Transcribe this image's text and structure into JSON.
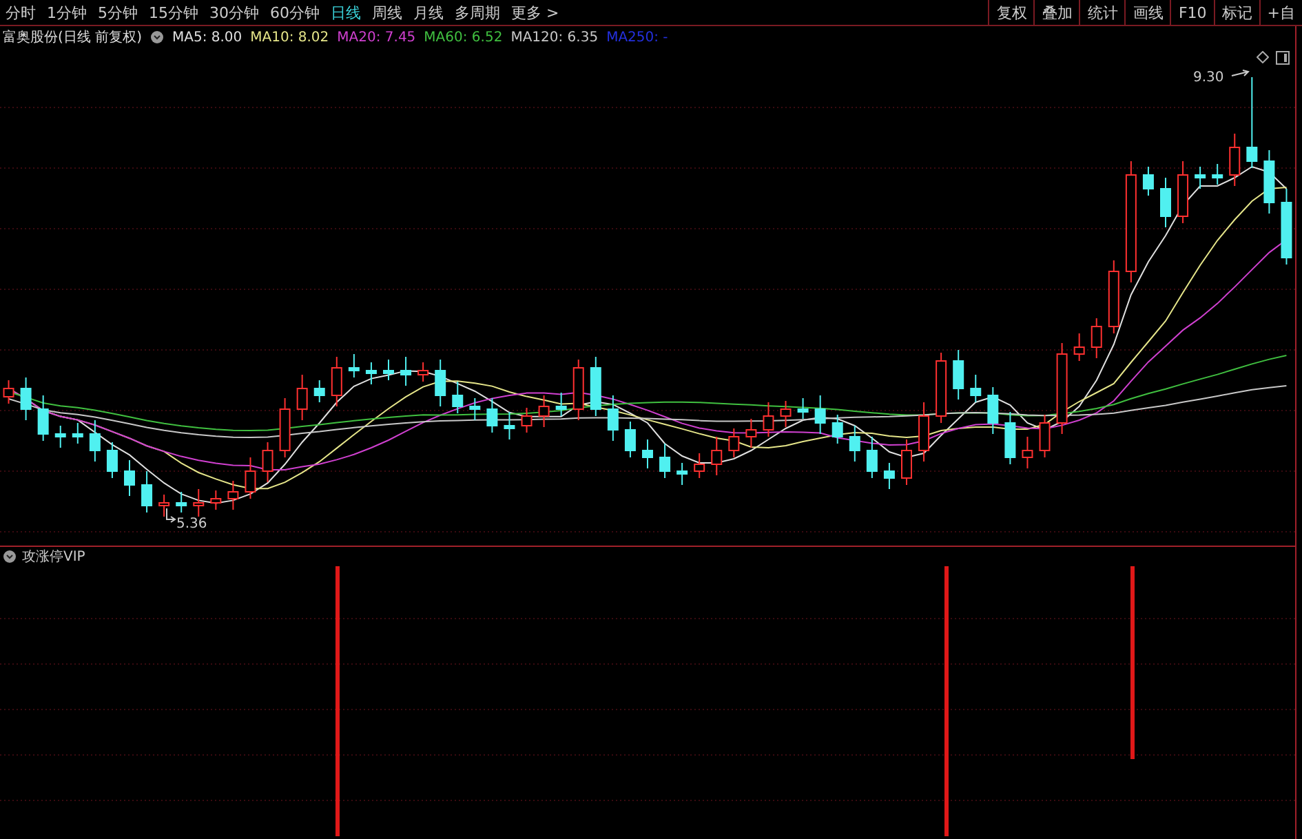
{
  "periods": [
    {
      "label": "分时",
      "selected": false
    },
    {
      "label": "1分钟",
      "selected": false
    },
    {
      "label": "5分钟",
      "selected": false
    },
    {
      "label": "15分钟",
      "selected": false
    },
    {
      "label": "30分钟",
      "selected": false
    },
    {
      "label": "60分钟",
      "selected": false
    },
    {
      "label": "日线",
      "selected": true
    },
    {
      "label": "周线",
      "selected": false
    },
    {
      "label": "月线",
      "selected": false
    },
    {
      "label": "多周期",
      "selected": false
    },
    {
      "label": "更多 >",
      "selected": false
    }
  ],
  "tools": [
    "复权",
    "叠加",
    "统计",
    "画线",
    "F10",
    "标记",
    "+自"
  ],
  "main_chart": {
    "title": "富奥股份(日线 前复权)",
    "indicators": [
      {
        "label": "MA5: 8.00",
        "color": "#e0e0e0"
      },
      {
        "label": "MA10: 8.02",
        "color": "#e6e68a"
      },
      {
        "label": "MA20: 7.45",
        "color": "#d040d0"
      },
      {
        "label": "MA60: 6.52",
        "color": "#40c040"
      },
      {
        "label": "MA120: 6.35",
        "color": "#c8c8c8"
      },
      {
        "label": "MA250: -",
        "color": "#2430e0"
      }
    ],
    "high_label": "9.30",
    "low_label": "5.36"
  },
  "indicator_panel": {
    "title": "攻涨停VIP"
  }
}
